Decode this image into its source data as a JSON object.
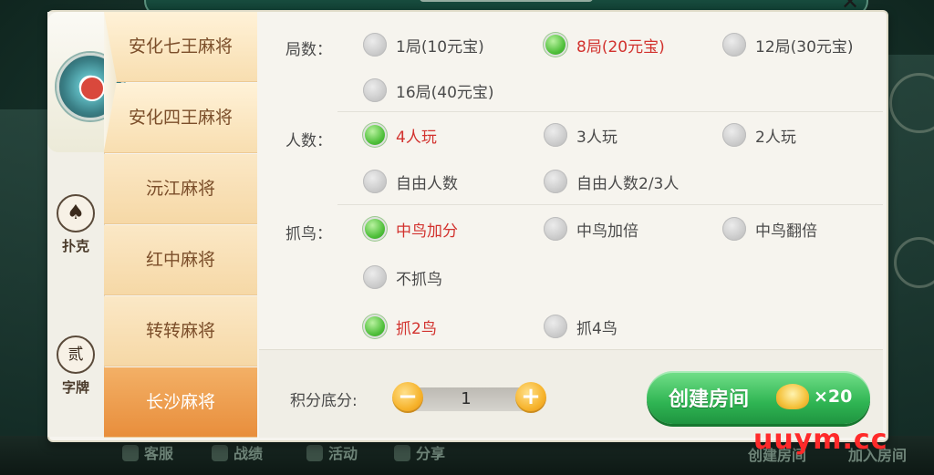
{
  "colors": {
    "selected_text": "#d2322e",
    "radio_on": "#4fbf3a",
    "create_button": "#2fb553"
  },
  "categories": [
    {
      "label": "",
      "icon": "mahjong-tile-icon"
    },
    {
      "label": "扑克",
      "icon": "spade-icon",
      "glyph": "♠"
    },
    {
      "label": "字牌",
      "icon": "character-tile-icon",
      "glyph": "贰"
    }
  ],
  "games": [
    "安化七王麻将",
    "安化四王麻将",
    "沅江麻将",
    "红中麻将",
    "转转麻将",
    "长沙麻将"
  ],
  "rounds": {
    "label": "局数：",
    "options": [
      "1局(10元宝)",
      "8局(20元宝)",
      "12局(30元宝)",
      "16局(40元宝)"
    ],
    "selected": "8局(20元宝)"
  },
  "players": {
    "label": "人数：",
    "options": [
      "4人玩",
      "3人玩",
      "2人玩",
      "自由人数",
      "自由人数2/3人"
    ],
    "selected": "4人玩"
  },
  "birds": {
    "label": "抓鸟：",
    "options": [
      "中鸟加分",
      "中鸟加倍",
      "中鸟翻倍",
      "不抓鸟"
    ],
    "selected": "中鸟加分",
    "count_options": [
      "抓2鸟",
      "抓4鸟"
    ],
    "count_selected": "抓2鸟"
  },
  "score": {
    "label": "积分底分:",
    "value": "1",
    "minus": "−",
    "plus": "+"
  },
  "create": {
    "label": "创建房间",
    "cost": "×20"
  },
  "bottom_bar": [
    "客服",
    "战绩",
    "活动",
    "分享",
    "创建房间",
    "加入房间"
  ],
  "watermark": "uuym.cc"
}
